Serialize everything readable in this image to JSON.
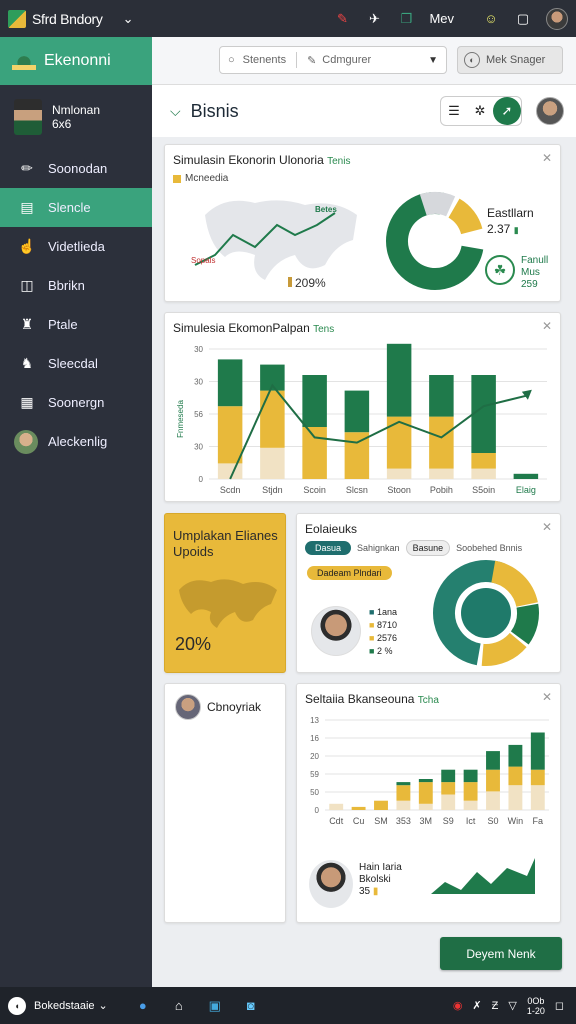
{
  "topbar": {
    "app_title": "Sfrd Bndory",
    "label_right": "Mev"
  },
  "sidebar": {
    "brand": "Ekenonni",
    "user": {
      "name": "Nmlonan",
      "sub": "6x6"
    },
    "items": [
      {
        "label": "Soonodan",
        "icon": "wrench-icon"
      },
      {
        "label": "Slencle",
        "icon": "file-icon",
        "active": true
      },
      {
        "label": "Videtlieda",
        "icon": "hand-icon"
      },
      {
        "label": "Bbrikn",
        "icon": "box-icon"
      },
      {
        "label": "Ptale",
        "icon": "person-icon"
      },
      {
        "label": "Sleecdal",
        "icon": "walker-icon"
      },
      {
        "label": "Soonergn",
        "icon": "calendar-icon"
      },
      {
        "label": "Aleckenlig",
        "icon": "avatar-icon"
      }
    ]
  },
  "toolbar": {
    "search_placeholder": "Stenents",
    "filter_label": "Cdmgurer",
    "action_label": "Mek Snager"
  },
  "header": {
    "title": "Bisnis"
  },
  "cards": {
    "c1": {
      "title": "Simulasin Ekonorin Ulonoria",
      "tag": "Tenis",
      "legend": "Mcneedia",
      "map_left": "Sopals",
      "map_right": "Betes",
      "map_pct": "209%",
      "donut_title": "Eastllarn",
      "donut_value": "2.37",
      "side_label": "Fanull",
      "side_sub1": "Mus",
      "side_sub2": "259"
    },
    "c2": {
      "title": "Simulesia EkomonPalpan",
      "tag": "Tens",
      "yaxis": "Fnmeseda"
    },
    "c3": {
      "title": "Umplakan Elianes",
      "subtitle": "Upoids",
      "pct": "20%"
    },
    "c4": {
      "title": "Eolaieuks",
      "chip1": "Dasua",
      "chip2": "Sahignkan",
      "chip3": "Basune",
      "chip4": "Soobehed Bnnis",
      "orange_chip": "Dadeam Plndari",
      "stats": [
        "1ana",
        "8710",
        "2576",
        "2 %"
      ]
    },
    "c5": {
      "title": "Cbnoyriak"
    },
    "c6": {
      "title": "Seltaiia Bkanseouna",
      "tag": "Tcha",
      "person_name": "Hain Iaria",
      "person_sub": "Bkolski",
      "person_val": "35"
    }
  },
  "action_button": "Deyem Nenk",
  "bottombar": {
    "start_label": "Bokedstaaie",
    "clock_line1": "0Ob",
    "clock_line2": "1-20"
  },
  "colors": {
    "green": "#1f7a4b",
    "yellow": "#e8b93a",
    "brand_green": "#3aa37d"
  },
  "chart_data": [
    {
      "type": "bar",
      "title": "Simulesia EkomonPalpan Tens",
      "ylabel": "Fnmeseda",
      "categories": [
        "Scdn",
        "Stjdn",
        "Scoin",
        "Slcsn",
        "Stoon",
        "Pobih",
        "S5oin",
        "Elaig"
      ],
      "series": [
        {
          "values": [
            3,
            6,
            0,
            0,
            2,
            2,
            2,
            0
          ]
        },
        {
          "values": [
            11,
            11,
            10,
            9,
            10,
            10,
            3,
            0
          ]
        },
        {
          "values": [
            9,
            5,
            10,
            8,
            14,
            8,
            15,
            1
          ]
        }
      ],
      "yticks": [
        "0",
        "30",
        "56",
        "30",
        "30"
      ],
      "line_values": [
        0,
        18,
        8,
        7,
        11,
        8,
        14,
        16
      ]
    },
    {
      "type": "bar",
      "title": "Seltaiia Bkanseouna Tcha",
      "categories": [
        "Cdt",
        "Cu",
        "SM",
        "353",
        "3M",
        "S9",
        "Ict",
        "S0",
        "Win",
        "Fa"
      ],
      "series": [
        {
          "values": [
            2,
            0,
            0,
            3,
            2,
            5,
            3,
            6,
            8,
            8
          ]
        },
        {
          "values": [
            0,
            1,
            3,
            5,
            7,
            4,
            6,
            7,
            6,
            5
          ]
        },
        {
          "values": [
            0,
            0,
            0,
            1,
            1,
            4,
            4,
            6,
            7,
            12
          ]
        }
      ],
      "yticks": [
        "0",
        "50",
        "59",
        "20",
        "16",
        "13"
      ]
    }
  ]
}
